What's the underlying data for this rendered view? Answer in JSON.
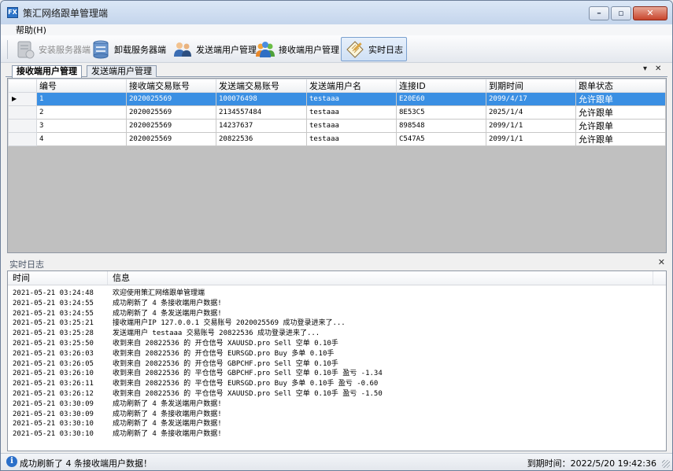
{
  "window": {
    "title": "策汇网络跟单管理端",
    "app_icon": "FX"
  },
  "menu": {
    "help": "帮助(H)"
  },
  "toolbar": {
    "items": [
      {
        "label": "安装服务器端",
        "icon": "server-install-icon",
        "disabled": true
      },
      {
        "label": "卸载服务器端",
        "icon": "server-uninstall-icon"
      },
      {
        "label": "发送端用户管理",
        "icon": "users-send-icon"
      },
      {
        "label": "接收端用户管理",
        "icon": "users-receive-icon"
      },
      {
        "label": "实时日志",
        "icon": "notepad-icon",
        "active": true
      }
    ]
  },
  "tabs": [
    {
      "label": "接收端用户管理",
      "active": true
    },
    {
      "label": "发送端用户管理",
      "active": false
    }
  ],
  "tab_controls": {
    "dropdown": "▾",
    "close": "✕"
  },
  "grid": {
    "columns": [
      "编号",
      "接收端交易账号",
      "发送端交易账号",
      "发送端用户名",
      "连接ID",
      "到期时间",
      "跟单状态"
    ],
    "rows": [
      [
        "1",
        "2020025569",
        "100076498",
        "testaaa",
        "E20E60",
        "2099/4/17",
        "允许跟单"
      ],
      [
        "2",
        "2020025569",
        "2134557484",
        "testaaa",
        "8E53C5",
        "2025/1/4",
        "允许跟单"
      ],
      [
        "3",
        "2020025569",
        "14237637",
        "testaaa",
        "898548",
        "2099/1/1",
        "允许跟单"
      ],
      [
        "4",
        "2020025569",
        "20822536",
        "testaaa",
        "C547A5",
        "2099/1/1",
        "允许跟单"
      ]
    ],
    "selected_row": 0
  },
  "log": {
    "title": "实时日志",
    "close": "✕",
    "col_time": "时间",
    "col_info": "信息",
    "entries": [
      {
        "time": "2021-05-21 03:24:48",
        "msg": "欢迎使用策汇网络跟单管理端"
      },
      {
        "time": "2021-05-21 03:24:55",
        "msg": "成功刷新了 4 条接收端用户数据!"
      },
      {
        "time": "2021-05-21 03:24:55",
        "msg": "成功刷新了 4 条发送端用户数据!"
      },
      {
        "time": "2021-05-21 03:25:21",
        "msg": "接收端用户IP 127.0.0.1 交易账号 2020025569 成功登录进来了..."
      },
      {
        "time": "2021-05-21 03:25:28",
        "msg": "发送端用户 testaaa 交易账号 20822536 成功登录进来了..."
      },
      {
        "time": "2021-05-21 03:25:50",
        "msg": "收到来自 20822536 的 开仓信号 XAUUSD.pro Sell 空单 0.10手"
      },
      {
        "time": "2021-05-21 03:26:03",
        "msg": "收到来自 20822536 的 开仓信号 EURSGD.pro Buy 多单 0.10手"
      },
      {
        "time": "2021-05-21 03:26:05",
        "msg": "收到来自 20822536 的 开仓信号 GBPCHF.pro Sell 空单 0.10手"
      },
      {
        "time": "2021-05-21 03:26:10",
        "msg": "收到来自 20822536 的 平仓信号 GBPCHF.pro Sell 空单 0.10手 盈亏 -1.34"
      },
      {
        "time": "2021-05-21 03:26:11",
        "msg": "收到来自 20822536 的 平仓信号 EURSGD.pro Buy 多单 0.10手 盈亏 -0.60"
      },
      {
        "time": "2021-05-21 03:26:12",
        "msg": "收到来自 20822536 的 平仓信号 XAUUSD.pro Sell 空单 0.10手 盈亏 -1.50"
      },
      {
        "time": "2021-05-21 03:30:09",
        "msg": "成功刷新了 4 条发送端用户数据!"
      },
      {
        "time": "2021-05-21 03:30:09",
        "msg": "成功刷新了 4 条接收端用户数据!"
      },
      {
        "time": "2021-05-21 03:30:10",
        "msg": "成功刷新了 4 条发送端用户数据!"
      },
      {
        "time": "2021-05-21 03:30:10",
        "msg": "成功刷新了 4 条接收端用户数据!"
      }
    ]
  },
  "status": {
    "message": "成功刷新了 4 条接收端用户数据！",
    "expiry": "到期时间：2022/5/20 19:42:36"
  }
}
